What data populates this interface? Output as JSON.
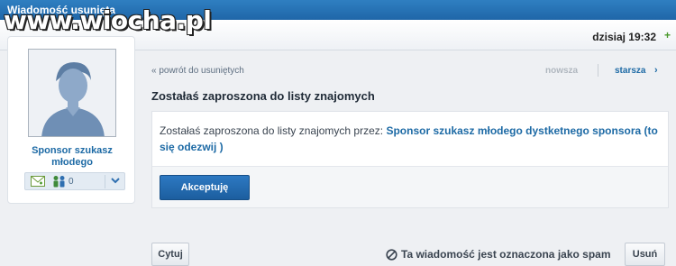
{
  "window": {
    "title": "Wiadomość usunięta"
  },
  "watermark": {
    "text": "www.wiocha.pl"
  },
  "header": {
    "datetime": "dzisiaj 19:32",
    "add_icon": "+"
  },
  "profile": {
    "name": "Sponsor szukasz młodego",
    "friends_count": "0",
    "icons": [
      "avatar-placeholder",
      "envelope-icon",
      "people-icon",
      "chevron-down-icon"
    ]
  },
  "navigation": {
    "back_link": "« powrót do usuniętych",
    "newer": "nowsza",
    "older": "starsza",
    "older_arrow": "›"
  },
  "message": {
    "subject": "Zostałaś zaproszona do listy znajomych",
    "body_prefix": "Zostałaś zaproszona do listy znajomych przez: ",
    "body_link": "Sponsor szukasz młodego dystketnego sponsora (to się odezwij )",
    "accept_label": "Akceptuję"
  },
  "footer": {
    "quote_label": "Cytuj",
    "spam_text": "Ta wiadomość jest oznaczona jako spam",
    "delete_label": "Usuń"
  },
  "colors": {
    "accent": "#1d6aa5",
    "header_bar": "#2f7fc1",
    "positive": "#4a9a2c"
  }
}
